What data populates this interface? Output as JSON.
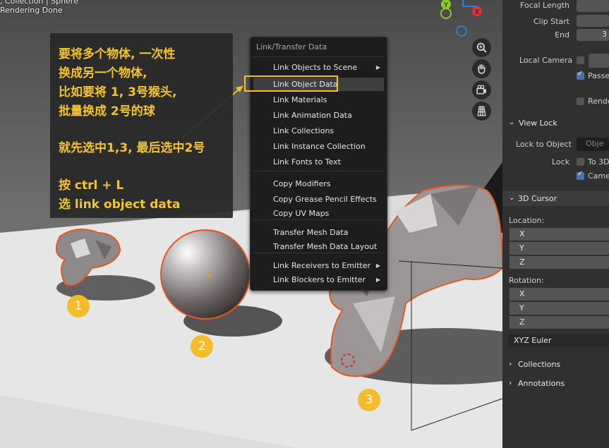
{
  "hud": {
    "line1": ", Collection | Sphere",
    "line2": "Rendering Done"
  },
  "annotation": {
    "lines": [
      "要将多个物体, 一次性",
      "换成另一个物体,",
      "比如要将 1, 3号猴头,",
      "批量换成 2号的球",
      "就先选中1,3, 最后选中2号",
      "按 ctrl + L",
      "选 link object data"
    ],
    "color": "#f4c430"
  },
  "menu": {
    "title": "Link/Transfer Data",
    "items": [
      {
        "label": "Link Objects to Scene",
        "submenu": true
      },
      {
        "label": "Link Object Data",
        "submenu": false
      },
      {
        "label": "Link Materials",
        "submenu": false
      },
      {
        "label": "Link Animation Data",
        "submenu": false
      },
      {
        "label": "Link Collections",
        "submenu": false
      },
      {
        "label": "Link Instance Collection",
        "submenu": false
      },
      {
        "label": "Link Fonts to Text",
        "submenu": false
      },
      {
        "label": "Copy Modifiers",
        "submenu": false
      },
      {
        "label": "Copy Grease Pencil Effects",
        "submenu": false
      },
      {
        "label": "Copy UV Maps",
        "submenu": false
      },
      {
        "label": "Transfer Mesh Data",
        "submenu": false
      },
      {
        "label": "Transfer Mesh Data Layout",
        "submenu": false
      },
      {
        "label": "Link Receivers to Emitter",
        "submenu": true
      },
      {
        "label": "Link Blockers to Emitter",
        "submenu": true
      }
    ],
    "arrow": "▶",
    "highlight_color": "#f2c22c"
  },
  "markers": [
    "1",
    "2",
    "3"
  ],
  "panel": {
    "focal_length": "Focal Length",
    "clip_start": "Clip Start",
    "end": "End",
    "end_value": "3",
    "local_camera": "Local Camera",
    "passepartout": "Passe",
    "render_region": "Rende",
    "view_lock_header": "View Lock",
    "lock_to_object": "Lock to Object",
    "lock_object_placeholder": "Obje",
    "lock": "Lock",
    "to_3d_cursor": "To 3D",
    "camera_to_view": "Came",
    "cursor_header": "3D Cursor",
    "location": "Location:",
    "rotation": "Rotation:",
    "axes": [
      "X",
      "Y",
      "Z"
    ],
    "rotation_mode": "XYZ Euler",
    "collections": "Collections",
    "annotations": "Annotations"
  },
  "gizmo": {
    "y_label": "Y",
    "x_label": "X",
    "colors": {
      "x": "#e0343f",
      "y": "#8ac926",
      "z": "#2f7ed8"
    }
  },
  "nav_icons": [
    "zoom-icon",
    "hand-pan-icon",
    "camera-view-icon",
    "grid-ortho-icon"
  ]
}
